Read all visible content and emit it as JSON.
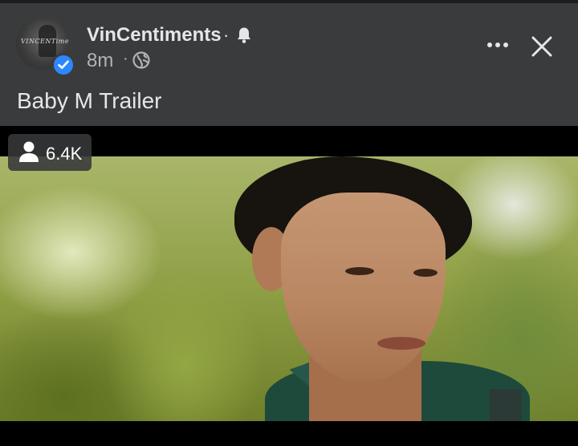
{
  "post": {
    "page_name": "VinCentiments",
    "name_separator": "·",
    "timestamp": "8m",
    "meta_separator": "·",
    "privacy_icon": "globe-icon",
    "title": "Baby M Trailer",
    "avatar_text": "VINCENTiments"
  },
  "video": {
    "viewer_count": "6.4K",
    "viewer_icon": "person-icon"
  },
  "colors": {
    "header_bg": "#3a3b3c",
    "verified_blue": "#2d88ff",
    "text_primary": "#e4e6eb",
    "text_secondary": "#b0b3b8"
  }
}
